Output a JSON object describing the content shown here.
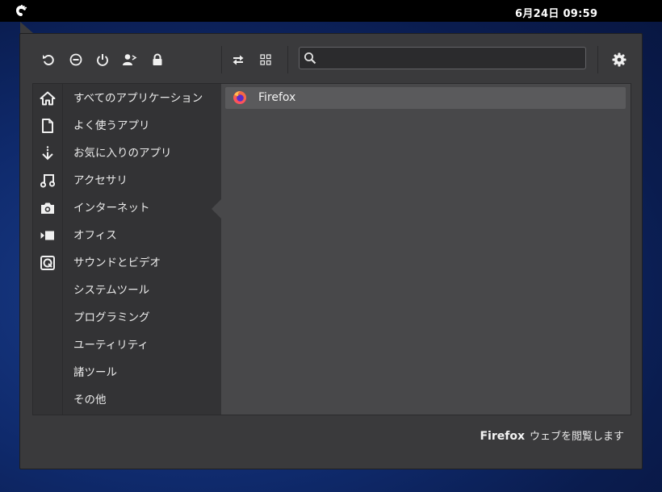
{
  "topbar": {
    "clock": "6月24日  09:59",
    "activities_icon": "gnome-foot-icon"
  },
  "toolbar": {
    "buttons": [
      {
        "name": "restart-icon"
      },
      {
        "name": "logout-icon"
      },
      {
        "name": "power-icon"
      },
      {
        "name": "switch-user-icon"
      },
      {
        "name": "lock-icon"
      },
      {
        "name": "toggle-view-icon"
      },
      {
        "name": "grid-view-icon"
      },
      {
        "name": "settings-gear-icon"
      }
    ],
    "search": {
      "value": "",
      "placeholder": ""
    }
  },
  "categories": [
    {
      "label": "すべてのアプリケーション",
      "icon": "home-icon"
    },
    {
      "label": "よく使うアプリ",
      "icon": "document-icon"
    },
    {
      "label": "お気に入りのアプリ",
      "icon": "download-arrow-icon"
    },
    {
      "label": "アクセサリ",
      "icon": "music-note-icon"
    },
    {
      "label": "インターネット",
      "icon": "camera-icon"
    },
    {
      "label": "オフィス",
      "icon": "video-icon"
    },
    {
      "label": "サウンドとビデオ",
      "icon": "disk-icon"
    },
    {
      "label": "システムツール",
      "icon": ""
    },
    {
      "label": "プログラミング",
      "icon": ""
    },
    {
      "label": "ユーティリティ",
      "icon": ""
    },
    {
      "label": "諸ツール",
      "icon": ""
    },
    {
      "label": "その他",
      "icon": ""
    }
  ],
  "selected_category": "インターネット",
  "apps": [
    {
      "name": "Firefox",
      "icon": "firefox-icon"
    }
  ],
  "description": {
    "app": "Firefox",
    "text": "ウェブを閲覧します"
  }
}
